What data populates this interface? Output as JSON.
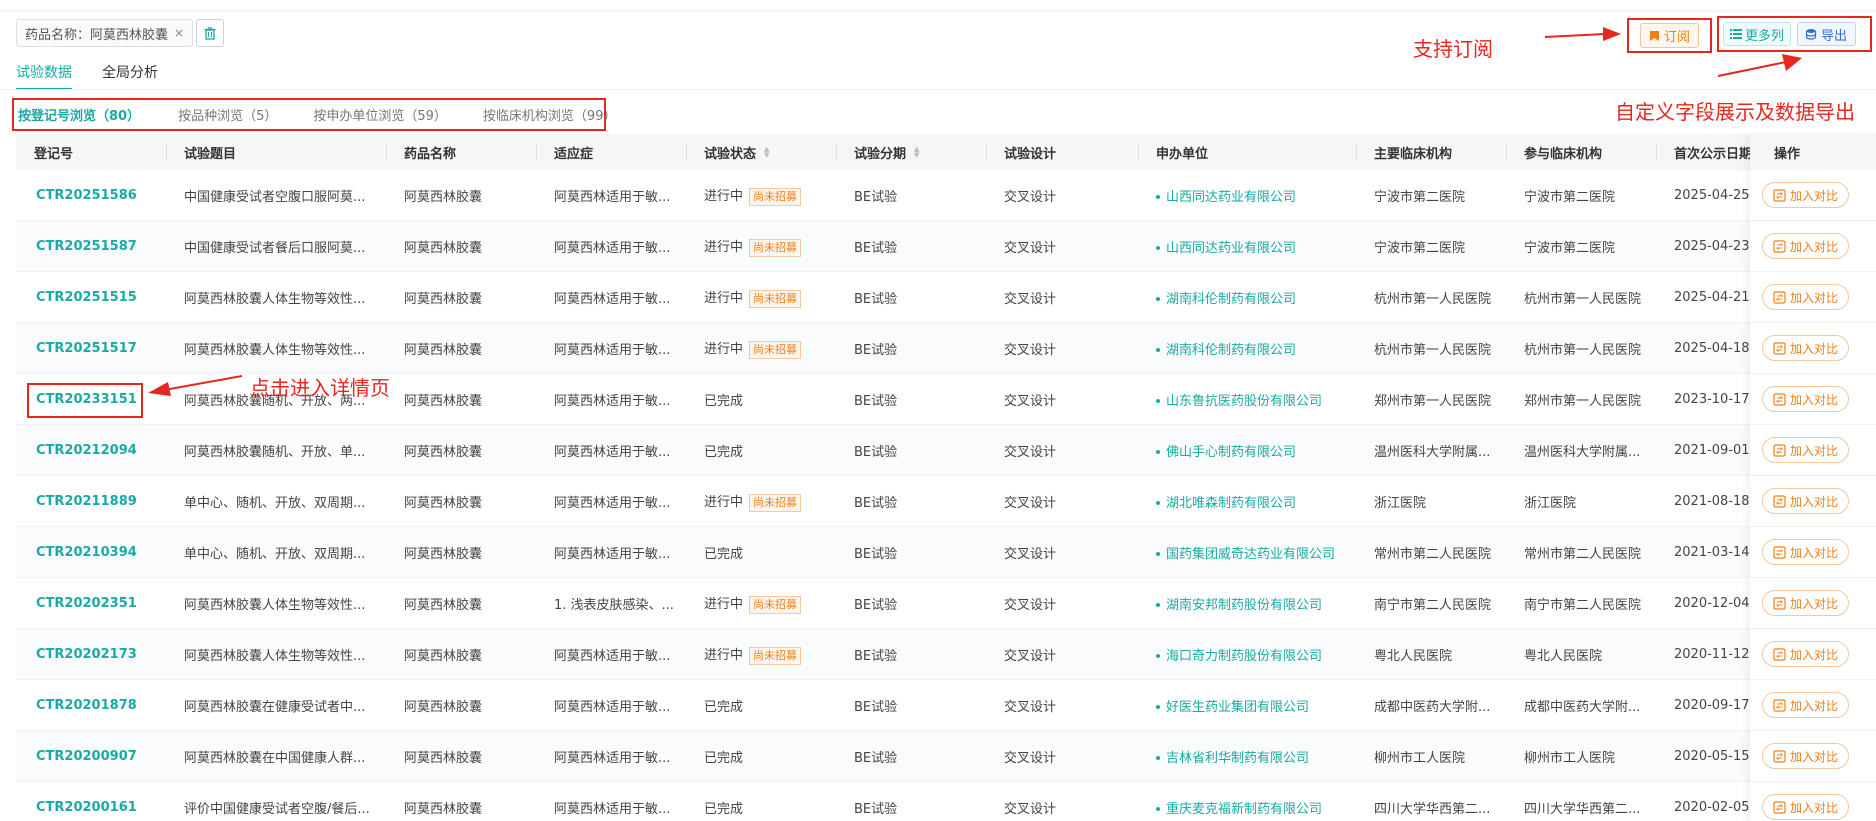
{
  "filter": {
    "tag_label": "药品名称：阿莫西林胶囊",
    "close_glyph": "×",
    "trash_icon": "trash-icon"
  },
  "main_tabs": [
    {
      "label": "试验数据",
      "active": true
    },
    {
      "label": "全局分析",
      "active": false
    }
  ],
  "sub_tabs": [
    {
      "label": "按登记号浏览（80）",
      "active": true
    },
    {
      "label": "按品种浏览（5）",
      "active": false
    },
    {
      "label": "按申办单位浏览（59）",
      "active": false
    },
    {
      "label": "按临床机构浏览（99）",
      "active": false
    }
  ],
  "toolbar": {
    "subscribe_label": "订阅",
    "more_columns_label": "更多列",
    "export_label": "导出"
  },
  "notes": {
    "subscribe": "支持订阅",
    "custom": "自定义字段展示及数据导出",
    "detail": "点击进入详情页"
  },
  "table": {
    "headers": [
      "登记号",
      "试验题目",
      "药品名称",
      "适应症",
      "试验状态",
      "试验分期",
      "试验设计",
      "申办单位",
      "主要临床机构",
      "参与临床机构",
      "首次公示日期"
    ],
    "op_header": "操作",
    "op_button": "加入对比",
    "rows": [
      [
        "CTR20251586",
        "中国健康受试者空腹口服阿莫...",
        "阿莫西林胶囊",
        "阿莫西林适用于敏...",
        "进行中",
        "尚未招募",
        "BE试验",
        "交叉设计",
        "山西同达药业有限公司",
        "宁波市第二医院",
        "宁波市第二医院",
        "2025-04-25"
      ],
      [
        "CTR20251587",
        "中国健康受试者餐后口服阿莫...",
        "阿莫西林胶囊",
        "阿莫西林适用于敏...",
        "进行中",
        "尚未招募",
        "BE试验",
        "交叉设计",
        "山西同达药业有限公司",
        "宁波市第二医院",
        "宁波市第二医院",
        "2025-04-23"
      ],
      [
        "CTR20251515",
        "阿莫西林胶囊人体生物等效性...",
        "阿莫西林胶囊",
        "阿莫西林适用于敏...",
        "进行中",
        "尚未招募",
        "BE试验",
        "交叉设计",
        "湖南科伦制药有限公司",
        "杭州市第一人民医院",
        "杭州市第一人民医院",
        "2025-04-21"
      ],
      [
        "CTR20251517",
        "阿莫西林胶囊人体生物等效性...",
        "阿莫西林胶囊",
        "阿莫西林适用于敏...",
        "进行中",
        "尚未招募",
        "BE试验",
        "交叉设计",
        "湖南科伦制药有限公司",
        "杭州市第一人民医院",
        "杭州市第一人民医院",
        "2025-04-18"
      ],
      [
        "CTR20233151",
        "阿莫西林胶囊随机、开放、两...",
        "阿莫西林胶囊",
        "阿莫西林适用于敏...",
        "已完成",
        "",
        "BE试验",
        "交叉设计",
        "山东鲁抗医药股份有限公司",
        "郑州市第一人民医院",
        "郑州市第一人民医院",
        "2023-10-17"
      ],
      [
        "CTR20212094",
        "阿莫西林胶囊随机、开放、单...",
        "阿莫西林胶囊",
        "阿莫西林适用于敏...",
        "已完成",
        "",
        "BE试验",
        "交叉设计",
        "佛山手心制药有限公司",
        "温州医科大学附属...",
        "温州医科大学附属...",
        "2021-09-01"
      ],
      [
        "CTR20211889",
        "单中心、随机、开放、双周期...",
        "阿莫西林胶囊",
        "阿莫西林适用于敏...",
        "进行中",
        "尚未招募",
        "BE试验",
        "交叉设计",
        "湖北唯森制药有限公司",
        "浙江医院",
        "浙江医院",
        "2021-08-18"
      ],
      [
        "CTR20210394",
        "单中心、随机、开放、双周期...",
        "阿莫西林胶囊",
        "阿莫西林适用于敏...",
        "已完成",
        "",
        "BE试验",
        "交叉设计",
        "国药集团威奇达药业有限公司",
        "常州市第二人民医院",
        "常州市第二人民医院",
        "2021-03-14"
      ],
      [
        "CTR20202351",
        "阿莫西林胶囊人体生物等效性...",
        "阿莫西林胶囊",
        "1. 浅表皮肤感染、...",
        "进行中",
        "尚未招募",
        "BE试验",
        "交叉设计",
        "湖南安邦制药股份有限公司",
        "南宁市第二人民医院",
        "南宁市第二人民医院",
        "2020-12-04"
      ],
      [
        "CTR20202173",
        "阿莫西林胶囊人体生物等效性...",
        "阿莫西林胶囊",
        "阿莫西林适用于敏...",
        "进行中",
        "尚未招募",
        "BE试验",
        "交叉设计",
        "海口奇力制药股份有限公司",
        "粤北人民医院",
        "粤北人民医院",
        "2020-11-12"
      ],
      [
        "CTR20201878",
        "阿莫西林胶囊在健康受试者中...",
        "阿莫西林胶囊",
        "阿莫西林适用于敏...",
        "已完成",
        "",
        "BE试验",
        "交叉设计",
        "好医生药业集团有限公司",
        "成都中医药大学附...",
        "成都中医药大学附...",
        "2020-09-17"
      ],
      [
        "CTR20200907",
        "阿莫西林胶囊在中国健康人群...",
        "阿莫西林胶囊",
        "阿莫西林适用于敏...",
        "已完成",
        "",
        "BE试验",
        "交叉设计",
        "吉林省利华制药有限公司",
        "柳州市工人医院",
        "柳州市工人医院",
        "2020-05-15"
      ],
      [
        "CTR20200161",
        "评价中国健康受试者空腹/餐后...",
        "阿莫西林胶囊",
        "阿莫西林适用于敏...",
        "已完成",
        "",
        "BE试验",
        "交叉设计",
        "重庆麦克福新制药有限公司",
        "四川大学华西第二...",
        "四川大学华西第二...",
        "2020-02-05"
      ]
    ]
  },
  "colors": {
    "accent": "#1aa9a4",
    "annotation": "#e5271d",
    "warning": "#f07f1a"
  }
}
